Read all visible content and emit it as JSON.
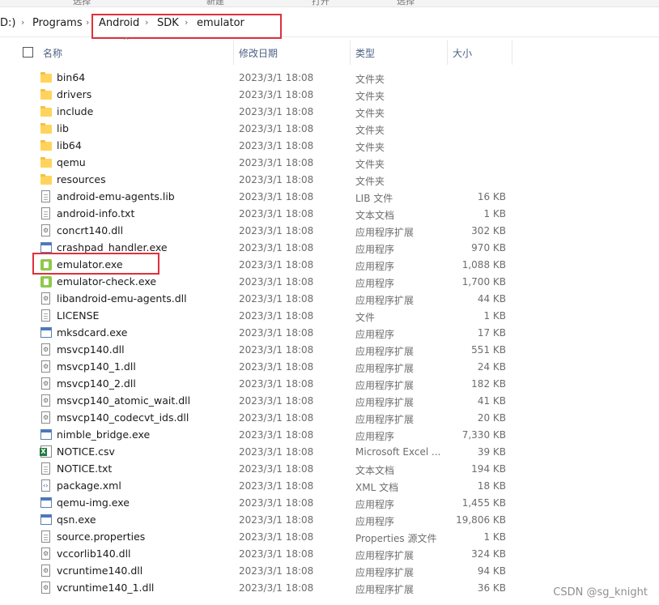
{
  "ribbon": {
    "partial_labels": [
      "选择",
      "新建",
      "打开",
      "选择"
    ]
  },
  "breadcrumb": {
    "drive_fragment": "D:)",
    "items": [
      "Programs",
      "Android",
      "SDK",
      "emulator"
    ]
  },
  "columns": {
    "name": "名称",
    "modified": "修改日期",
    "type": "类型",
    "size": "大小"
  },
  "files": [
    {
      "name": "bin64",
      "date": "2023/3/1 18:08",
      "type": "文件夹",
      "size": "",
      "icon": "folder-icon"
    },
    {
      "name": "drivers",
      "date": "2023/3/1 18:08",
      "type": "文件夹",
      "size": "",
      "icon": "folder-icon"
    },
    {
      "name": "include",
      "date": "2023/3/1 18:08",
      "type": "文件夹",
      "size": "",
      "icon": "folder-icon"
    },
    {
      "name": "lib",
      "date": "2023/3/1 18:08",
      "type": "文件夹",
      "size": "",
      "icon": "folder-icon"
    },
    {
      "name": "lib64",
      "date": "2023/3/1 18:08",
      "type": "文件夹",
      "size": "",
      "icon": "folder-icon"
    },
    {
      "name": "qemu",
      "date": "2023/3/1 18:08",
      "type": "文件夹",
      "size": "",
      "icon": "folder-icon"
    },
    {
      "name": "resources",
      "date": "2023/3/1 18:08",
      "type": "文件夹",
      "size": "",
      "icon": "folder-icon"
    },
    {
      "name": "android-emu-agents.lib",
      "date": "2023/3/1 18:08",
      "type": "LIB 文件",
      "size": "16 KB",
      "icon": "file-icon"
    },
    {
      "name": "android-info.txt",
      "date": "2023/3/1 18:08",
      "type": "文本文档",
      "size": "1 KB",
      "icon": "text-file-icon"
    },
    {
      "name": "concrt140.dll",
      "date": "2023/3/1 18:08",
      "type": "应用程序扩展",
      "size": "302 KB",
      "icon": "dll-icon"
    },
    {
      "name": "crashpad_handler.exe",
      "date": "2023/3/1 18:08",
      "type": "应用程序",
      "size": "970 KB",
      "icon": "exe-icon"
    },
    {
      "name": "emulator.exe",
      "date": "2023/3/1 18:08",
      "type": "应用程序",
      "size": "1,088 KB",
      "icon": "emulator-app-icon"
    },
    {
      "name": "emulator-check.exe",
      "date": "2023/3/1 18:08",
      "type": "应用程序",
      "size": "1,700 KB",
      "icon": "emulator-app-icon"
    },
    {
      "name": "libandroid-emu-agents.dll",
      "date": "2023/3/1 18:08",
      "type": "应用程序扩展",
      "size": "44 KB",
      "icon": "dll-icon"
    },
    {
      "name": "LICENSE",
      "date": "2023/3/1 18:08",
      "type": "文件",
      "size": "1 KB",
      "icon": "file-icon"
    },
    {
      "name": "mksdcard.exe",
      "date": "2023/3/1 18:08",
      "type": "应用程序",
      "size": "17 KB",
      "icon": "exe-icon"
    },
    {
      "name": "msvcp140.dll",
      "date": "2023/3/1 18:08",
      "type": "应用程序扩展",
      "size": "551 KB",
      "icon": "dll-icon"
    },
    {
      "name": "msvcp140_1.dll",
      "date": "2023/3/1 18:08",
      "type": "应用程序扩展",
      "size": "24 KB",
      "icon": "dll-icon"
    },
    {
      "name": "msvcp140_2.dll",
      "date": "2023/3/1 18:08",
      "type": "应用程序扩展",
      "size": "182 KB",
      "icon": "dll-icon"
    },
    {
      "name": "msvcp140_atomic_wait.dll",
      "date": "2023/3/1 18:08",
      "type": "应用程序扩展",
      "size": "41 KB",
      "icon": "dll-icon"
    },
    {
      "name": "msvcp140_codecvt_ids.dll",
      "date": "2023/3/1 18:08",
      "type": "应用程序扩展",
      "size": "20 KB",
      "icon": "dll-icon"
    },
    {
      "name": "nimble_bridge.exe",
      "date": "2023/3/1 18:08",
      "type": "应用程序",
      "size": "7,330 KB",
      "icon": "exe-icon"
    },
    {
      "name": "NOTICE.csv",
      "date": "2023/3/1 18:08",
      "type": "Microsoft Excel ...",
      "size": "39 KB",
      "icon": "excel-icon"
    },
    {
      "name": "NOTICE.txt",
      "date": "2023/3/1 18:08",
      "type": "文本文档",
      "size": "194 KB",
      "icon": "text-file-icon"
    },
    {
      "name": "package.xml",
      "date": "2023/3/1 18:08",
      "type": "XML 文档",
      "size": "18 KB",
      "icon": "xml-icon"
    },
    {
      "name": "qemu-img.exe",
      "date": "2023/3/1 18:08",
      "type": "应用程序",
      "size": "1,455 KB",
      "icon": "exe-icon"
    },
    {
      "name": "qsn.exe",
      "date": "2023/3/1 18:08",
      "type": "应用程序",
      "size": "19,806 KB",
      "icon": "exe-icon"
    },
    {
      "name": "source.properties",
      "date": "2023/3/1 18:08",
      "type": "Properties 源文件",
      "size": "1 KB",
      "icon": "file-icon"
    },
    {
      "name": "vccorlib140.dll",
      "date": "2023/3/1 18:08",
      "type": "应用程序扩展",
      "size": "324 KB",
      "icon": "dll-icon"
    },
    {
      "name": "vcruntime140.dll",
      "date": "2023/3/1 18:08",
      "type": "应用程序扩展",
      "size": "94 KB",
      "icon": "dll-icon"
    },
    {
      "name": "vcruntime140_1.dll",
      "date": "2023/3/1 18:08",
      "type": "应用程序扩展",
      "size": "36 KB",
      "icon": "dll-icon"
    }
  ],
  "annotation_color": "#e0303a",
  "watermark": "CSDN @sg_knight"
}
